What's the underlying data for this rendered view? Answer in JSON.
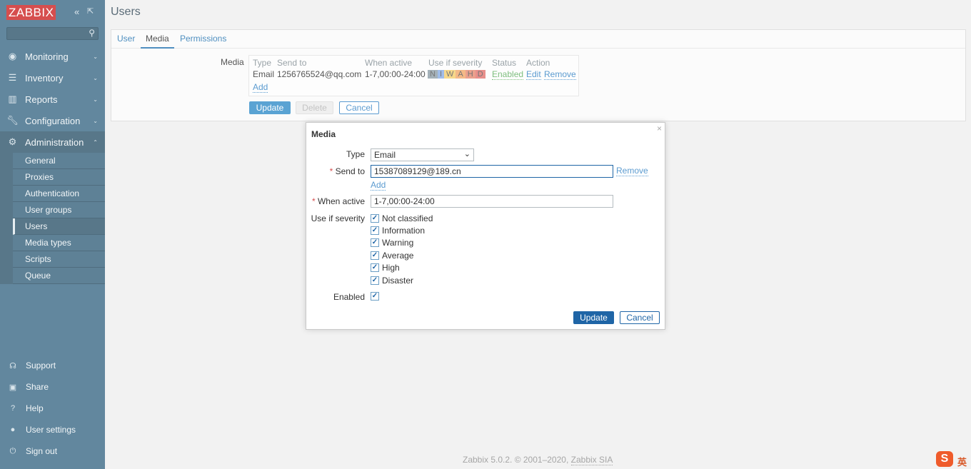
{
  "sidebar": {
    "logo": "ZABBIX",
    "search_placeholder": "",
    "menu": [
      {
        "label": "Monitoring",
        "icon": "eye-icon"
      },
      {
        "label": "Inventory",
        "icon": "list-icon"
      },
      {
        "label": "Reports",
        "icon": "bar-chart-icon"
      },
      {
        "label": "Configuration",
        "icon": "wrench-icon"
      },
      {
        "label": "Administration",
        "icon": "gear-icon"
      }
    ],
    "submenu": [
      "General",
      "Proxies",
      "Authentication",
      "User groups",
      "Users",
      "Media types",
      "Scripts",
      "Queue"
    ],
    "active_sub": "Users",
    "bottom": [
      {
        "label": "Support",
        "icon": "headset-icon"
      },
      {
        "label": "Share",
        "icon": "share-icon"
      },
      {
        "label": "Help",
        "icon": "help-icon"
      },
      {
        "label": "User settings",
        "icon": "user-icon"
      },
      {
        "label": "Sign out",
        "icon": "power-icon"
      }
    ]
  },
  "page": {
    "title": "Users",
    "tabs": [
      "User",
      "Media",
      "Permissions"
    ],
    "active_tab": "Media",
    "media_label": "Media",
    "table": {
      "headers": [
        "Type",
        "Send to",
        "When active",
        "Use if severity",
        "Status",
        "Action"
      ],
      "rows": [
        {
          "type": "Email",
          "send_to": "1256765524@qq.com",
          "when_active": "1-7,00:00-24:00",
          "severity": [
            "N",
            "I",
            "W",
            "A",
            "H",
            "D"
          ],
          "status": "Enabled",
          "edit": "Edit",
          "remove": "Remove"
        }
      ],
      "add": "Add"
    },
    "buttons": {
      "update": "Update",
      "delete": "Delete",
      "cancel": "Cancel"
    }
  },
  "modal": {
    "title": "Media",
    "type_label": "Type",
    "type_value": "Email",
    "send_to_label": "Send to",
    "send_to_value": "15387089129@189.cn",
    "remove": "Remove",
    "add": "Add",
    "when_active_label": "When active",
    "when_active_value": "1-7,00:00-24:00",
    "severity_label": "Use if severity",
    "severities": [
      {
        "label": "Not classified",
        "checked": true
      },
      {
        "label": "Information",
        "checked": true
      },
      {
        "label": "Warning",
        "checked": true
      },
      {
        "label": "Average",
        "checked": true
      },
      {
        "label": "High",
        "checked": true
      },
      {
        "label": "Disaster",
        "checked": true
      }
    ],
    "enabled_label": "Enabled",
    "enabled": true,
    "update": "Update",
    "cancel": "Cancel"
  },
  "footer": {
    "text": "Zabbix 5.0.2. © 2001–2020,",
    "link": "Zabbix SIA"
  },
  "ime": {
    "label": "英"
  },
  "colors": {
    "sidebar": "#62879e",
    "accent": "#1f65a6",
    "logo": "#d64e4e"
  }
}
